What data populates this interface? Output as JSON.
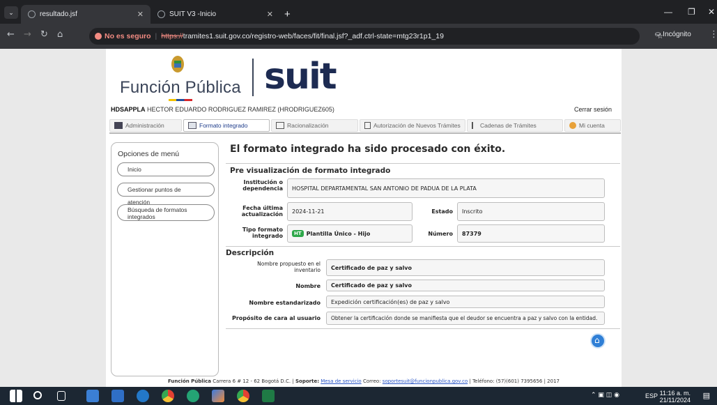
{
  "browser": {
    "tab1": "resultado.jsf",
    "tab2": "SUIT V3 -Inicio",
    "new_tab": "+",
    "security": "No es seguro",
    "url_scheme": "https://",
    "url_rest": "tramites1.suit.gov.co/registro-web/faces/fit/final.jsf?_adf.ctrl-state=mtg23r1p1_19",
    "incognito": "Incógnito"
  },
  "header": {
    "brand": "Función Pública",
    "product": "suit"
  },
  "user": {
    "code": "HDSAPPLA",
    "name": "HECTOR EDUARDO RODRIGUEZ RAMIREZ (HRODRIGUEZ605)",
    "logout": "Cerrar sesión"
  },
  "tabs": [
    "Administración",
    "Formato integrado",
    "Racionalización",
    "Autorización de Nuevos Trámites",
    "Cadenas de Trámites",
    "Mi cuenta"
  ],
  "menu": {
    "title": "Opciones de menú",
    "items": [
      "Inicio",
      "Gestionar puntos de atención",
      "Búsqueda de formatos integrados"
    ]
  },
  "main": {
    "title": "El formato integrado ha sido procesado con éxito.",
    "preview_title": "Pre visualización de formato integrado",
    "institution_label": "Institución o dependencia",
    "institution": "HOSPITAL DEPARTAMENTAL SAN ANTONIO DE PADUA DE LA PLATA",
    "date_label": "Fecha última actualización",
    "date": "2024-11-21",
    "status_label": "Estado",
    "status": "Inscrito",
    "type_label": "Tipo formato integrado",
    "type_badge": "HT",
    "type": "Plantilla Único - Hijo",
    "number_label": "Número",
    "number": "87379",
    "desc_title": "Descripción",
    "proposed_label": "Nombre propuesto en el inventario",
    "proposed": "Certificado de paz y salvo",
    "name_label": "Nombre",
    "name": "Certificado de paz y salvo",
    "std_label": "Nombre estandarizado",
    "std": "Expedición  certificación(es)  de paz y salvo",
    "purpose_label": "Propósito de cara al usuario",
    "purpose": "Obtener la certificación donde se manifiesta que el deudor se encuentra a paz y salvo con la entidad."
  },
  "footer": {
    "org": "Función Pública",
    "address": "Carrera 6 # 12 - 62 Bogotá D.C. |",
    "support_label": "Soporte:",
    "support_link": "Mesa de servicio",
    "mail_label": "Correo:",
    "mail": "soportesuit@funcionpublica.gov.co",
    "rest": "| Teléfono: (57)(601) 7395656 | 2017"
  },
  "taskbar": {
    "lang": "ESP",
    "time": "11:16 a. m.",
    "date": "21/11/2024"
  }
}
